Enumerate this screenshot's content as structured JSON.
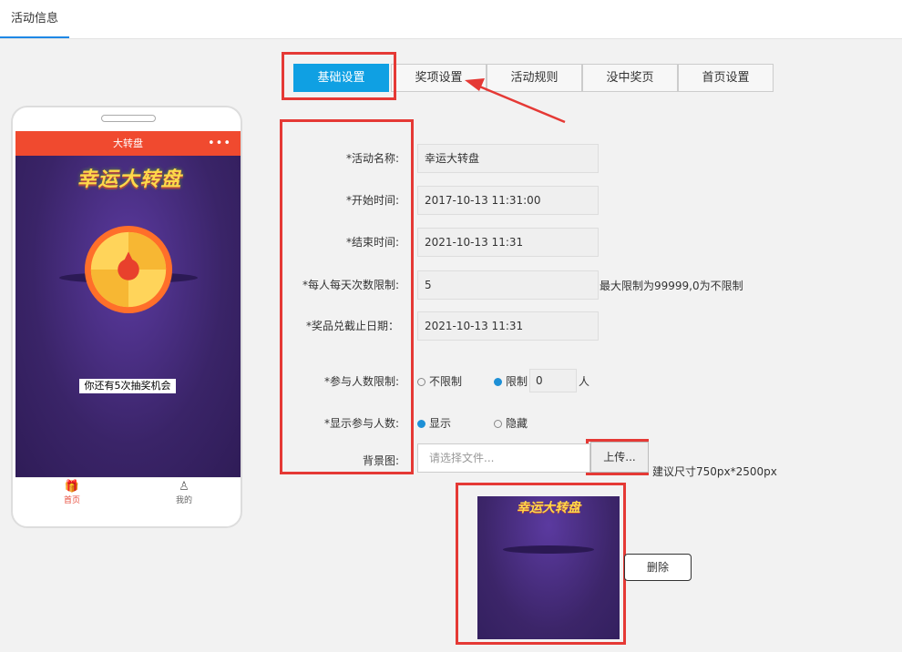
{
  "top_tab": "活动信息",
  "tabs": [
    "基础设置",
    "奖项设置",
    "活动规则",
    "没中奖页",
    "首页设置"
  ],
  "phone": {
    "header_title": "大转盘",
    "header_dots": "•••",
    "banner_title": "幸运大转盘",
    "chance_text": "你还有5次抽奖机会",
    "nav_home": "首页",
    "nav_mine": "我的",
    "nav_home_icon": "gift-icon",
    "nav_mine_icon": "user-icon"
  },
  "form": {
    "name_label": "*活动名称:",
    "name_value": "幸运大转盘",
    "start_label": "*开始时间:",
    "start_value": "2017-10-13 11:31:00",
    "end_label": "*结束时间:",
    "end_value": "2021-10-13 11:31",
    "limit_label": "*每人每天次数限制:",
    "limit_value": "5",
    "limit_hint": "最大限制为99999,0为不限制",
    "deadline_label": "*奖品兑截止日期：",
    "deadline_value": "2021-10-13 11:31",
    "participants_label": "*参与人数限制:",
    "participants_unlimited": "不限制",
    "participants_limited": "限制",
    "participants_value": "0",
    "participants_unit": "人",
    "show_label": "*显示参与人数:",
    "show_option": "显示",
    "hide_option": "隐藏",
    "bg_label": "背景图:",
    "file_placeholder": "请选择文件...",
    "upload_label": "上传...",
    "size_hint": "建议尺寸750px*2500px",
    "preview_title": "幸运大转盘",
    "delete_label": "删除"
  },
  "colors": {
    "accent": "#0fa0e3",
    "highlight": "#e53935",
    "phone_header": "#f04a2f",
    "screen_bg": "#3f2a6b"
  }
}
